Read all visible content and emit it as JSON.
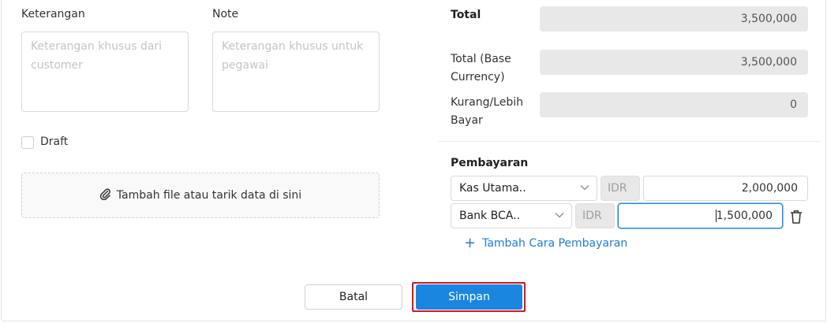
{
  "form": {
    "keterangan_label": "Keterangan",
    "keterangan_placeholder_line1": "Keterangan khusus dari",
    "keterangan_placeholder_line2": "customer",
    "note_label": "Note",
    "note_placeholder_line1": "Keterangan khusus untuk",
    "note_placeholder_line2": "pegawai",
    "draft_label": "Draft",
    "draft_checked": false,
    "upload_text": "Tambah file atau tarik data di sini"
  },
  "summary": {
    "total_label": "Total",
    "total_value": "3,500,000",
    "total_base_label_line1": "Total (Base",
    "total_base_label_line2": "Currency)",
    "total_base_value": "3,500,000",
    "kurang_label_line1": "Kurang/Lebih",
    "kurang_label_line2": "Bayar",
    "kurang_value": "0"
  },
  "payment": {
    "title": "Pembayaran",
    "rows": [
      {
        "method": "Kas Utama..",
        "currency": "IDR",
        "amount": "2,000,000"
      },
      {
        "method": "Bank BCA..",
        "currency": "IDR",
        "amount": "1,500,000"
      }
    ],
    "add_label": "Tambah Cara Pembayaran"
  },
  "actions": {
    "cancel_label": "Batal",
    "save_label": "Simpan"
  },
  "colors": {
    "primary": "#1a86e0",
    "highlight": "#d8161b",
    "link": "#1e7ed6"
  }
}
